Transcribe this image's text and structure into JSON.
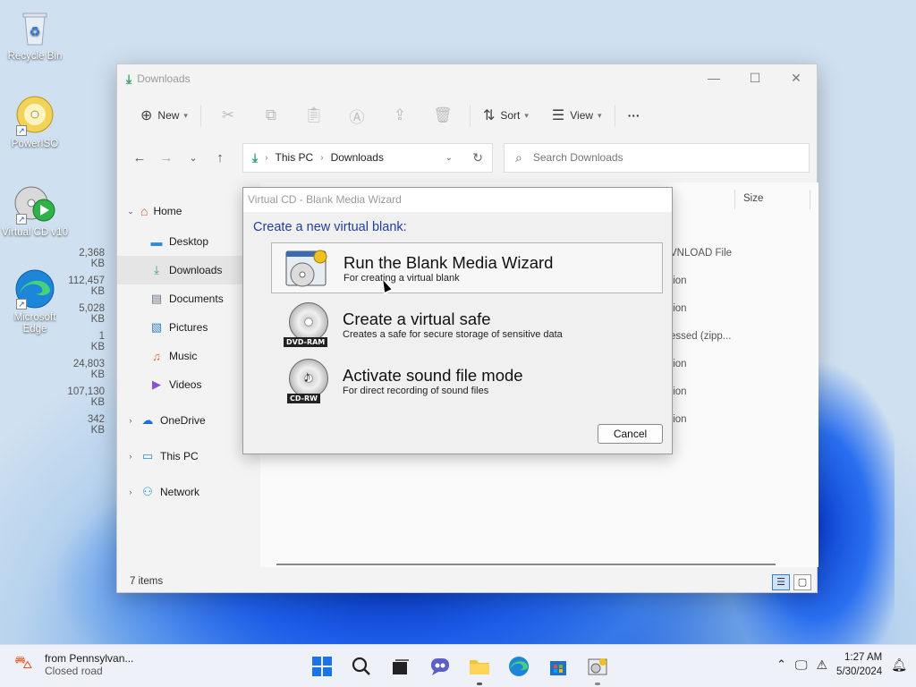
{
  "desktop": {
    "icons": [
      {
        "label": "Recycle Bin",
        "icon": "recycle-bin-icon"
      },
      {
        "label": "PowerISO",
        "icon": "poweriso-icon"
      },
      {
        "label": "Virtual CD v10",
        "icon": "virtual-cd-icon"
      },
      {
        "label": "Microsoft Edge",
        "icon": "edge-icon"
      }
    ]
  },
  "explorer": {
    "title": "Downloads",
    "toolbar": {
      "new_label": "New",
      "sort_label": "Sort",
      "view_label": "View",
      "more_label": "···"
    },
    "address": {
      "parts": [
        "This PC",
        "Downloads"
      ]
    },
    "search": {
      "placeholder": "Search Downloads"
    },
    "sidebar": {
      "items": [
        {
          "label": "Home",
          "icon": "home-icon"
        },
        {
          "label": "Desktop",
          "icon": "desktop-icon"
        },
        {
          "label": "Downloads",
          "icon": "download-icon",
          "selected": true
        },
        {
          "label": "Documents",
          "icon": "documents-icon"
        },
        {
          "label": "Pictures",
          "icon": "pictures-icon"
        },
        {
          "label": "Music",
          "icon": "music-icon"
        },
        {
          "label": "Videos",
          "icon": "videos-icon"
        },
        {
          "label": "OneDrive",
          "icon": "onedrive-icon"
        },
        {
          "label": "This PC",
          "icon": "this-pc-icon"
        },
        {
          "label": "Network",
          "icon": "network-icon"
        }
      ]
    },
    "columns": {
      "size": "Size"
    },
    "rows": [
      {
        "type": "VNLOAD File",
        "size": "2,368 KB"
      },
      {
        "type": "tion",
        "size": "112,457 KB"
      },
      {
        "type": "tion",
        "size": "5,028 KB"
      },
      {
        "type": "essed (zipp...",
        "size": "1 KB"
      },
      {
        "type": "tion",
        "size": "24,803 KB"
      },
      {
        "type": "tion",
        "size": "107,130 KB"
      },
      {
        "type": "tion",
        "size": "342 KB"
      }
    ],
    "status": "7 items"
  },
  "dialog": {
    "title": "Virtual CD - Blank Media Wizard",
    "heading": "Create a new virtual blank:",
    "options": [
      {
        "title": "Run the Blank Media Wizard",
        "subtitle": "For creating a virtual blank",
        "badge": ""
      },
      {
        "title": "Create a virtual safe",
        "subtitle": "Creates a safe for secure storage of sensitive data",
        "badge": "DVD-RAM"
      },
      {
        "title": "Activate sound file mode",
        "subtitle": "For direct recording of sound files",
        "badge": "CD-RW"
      }
    ],
    "cancel_label": "Cancel"
  },
  "taskbar": {
    "weather_line1": "from Pennsylvan...",
    "weather_line2": "Closed road",
    "time": "1:27 AM",
    "date": "5/30/2024"
  },
  "colors": {
    "accent": "#1f3f9d",
    "download_green": "#2fa36b"
  }
}
